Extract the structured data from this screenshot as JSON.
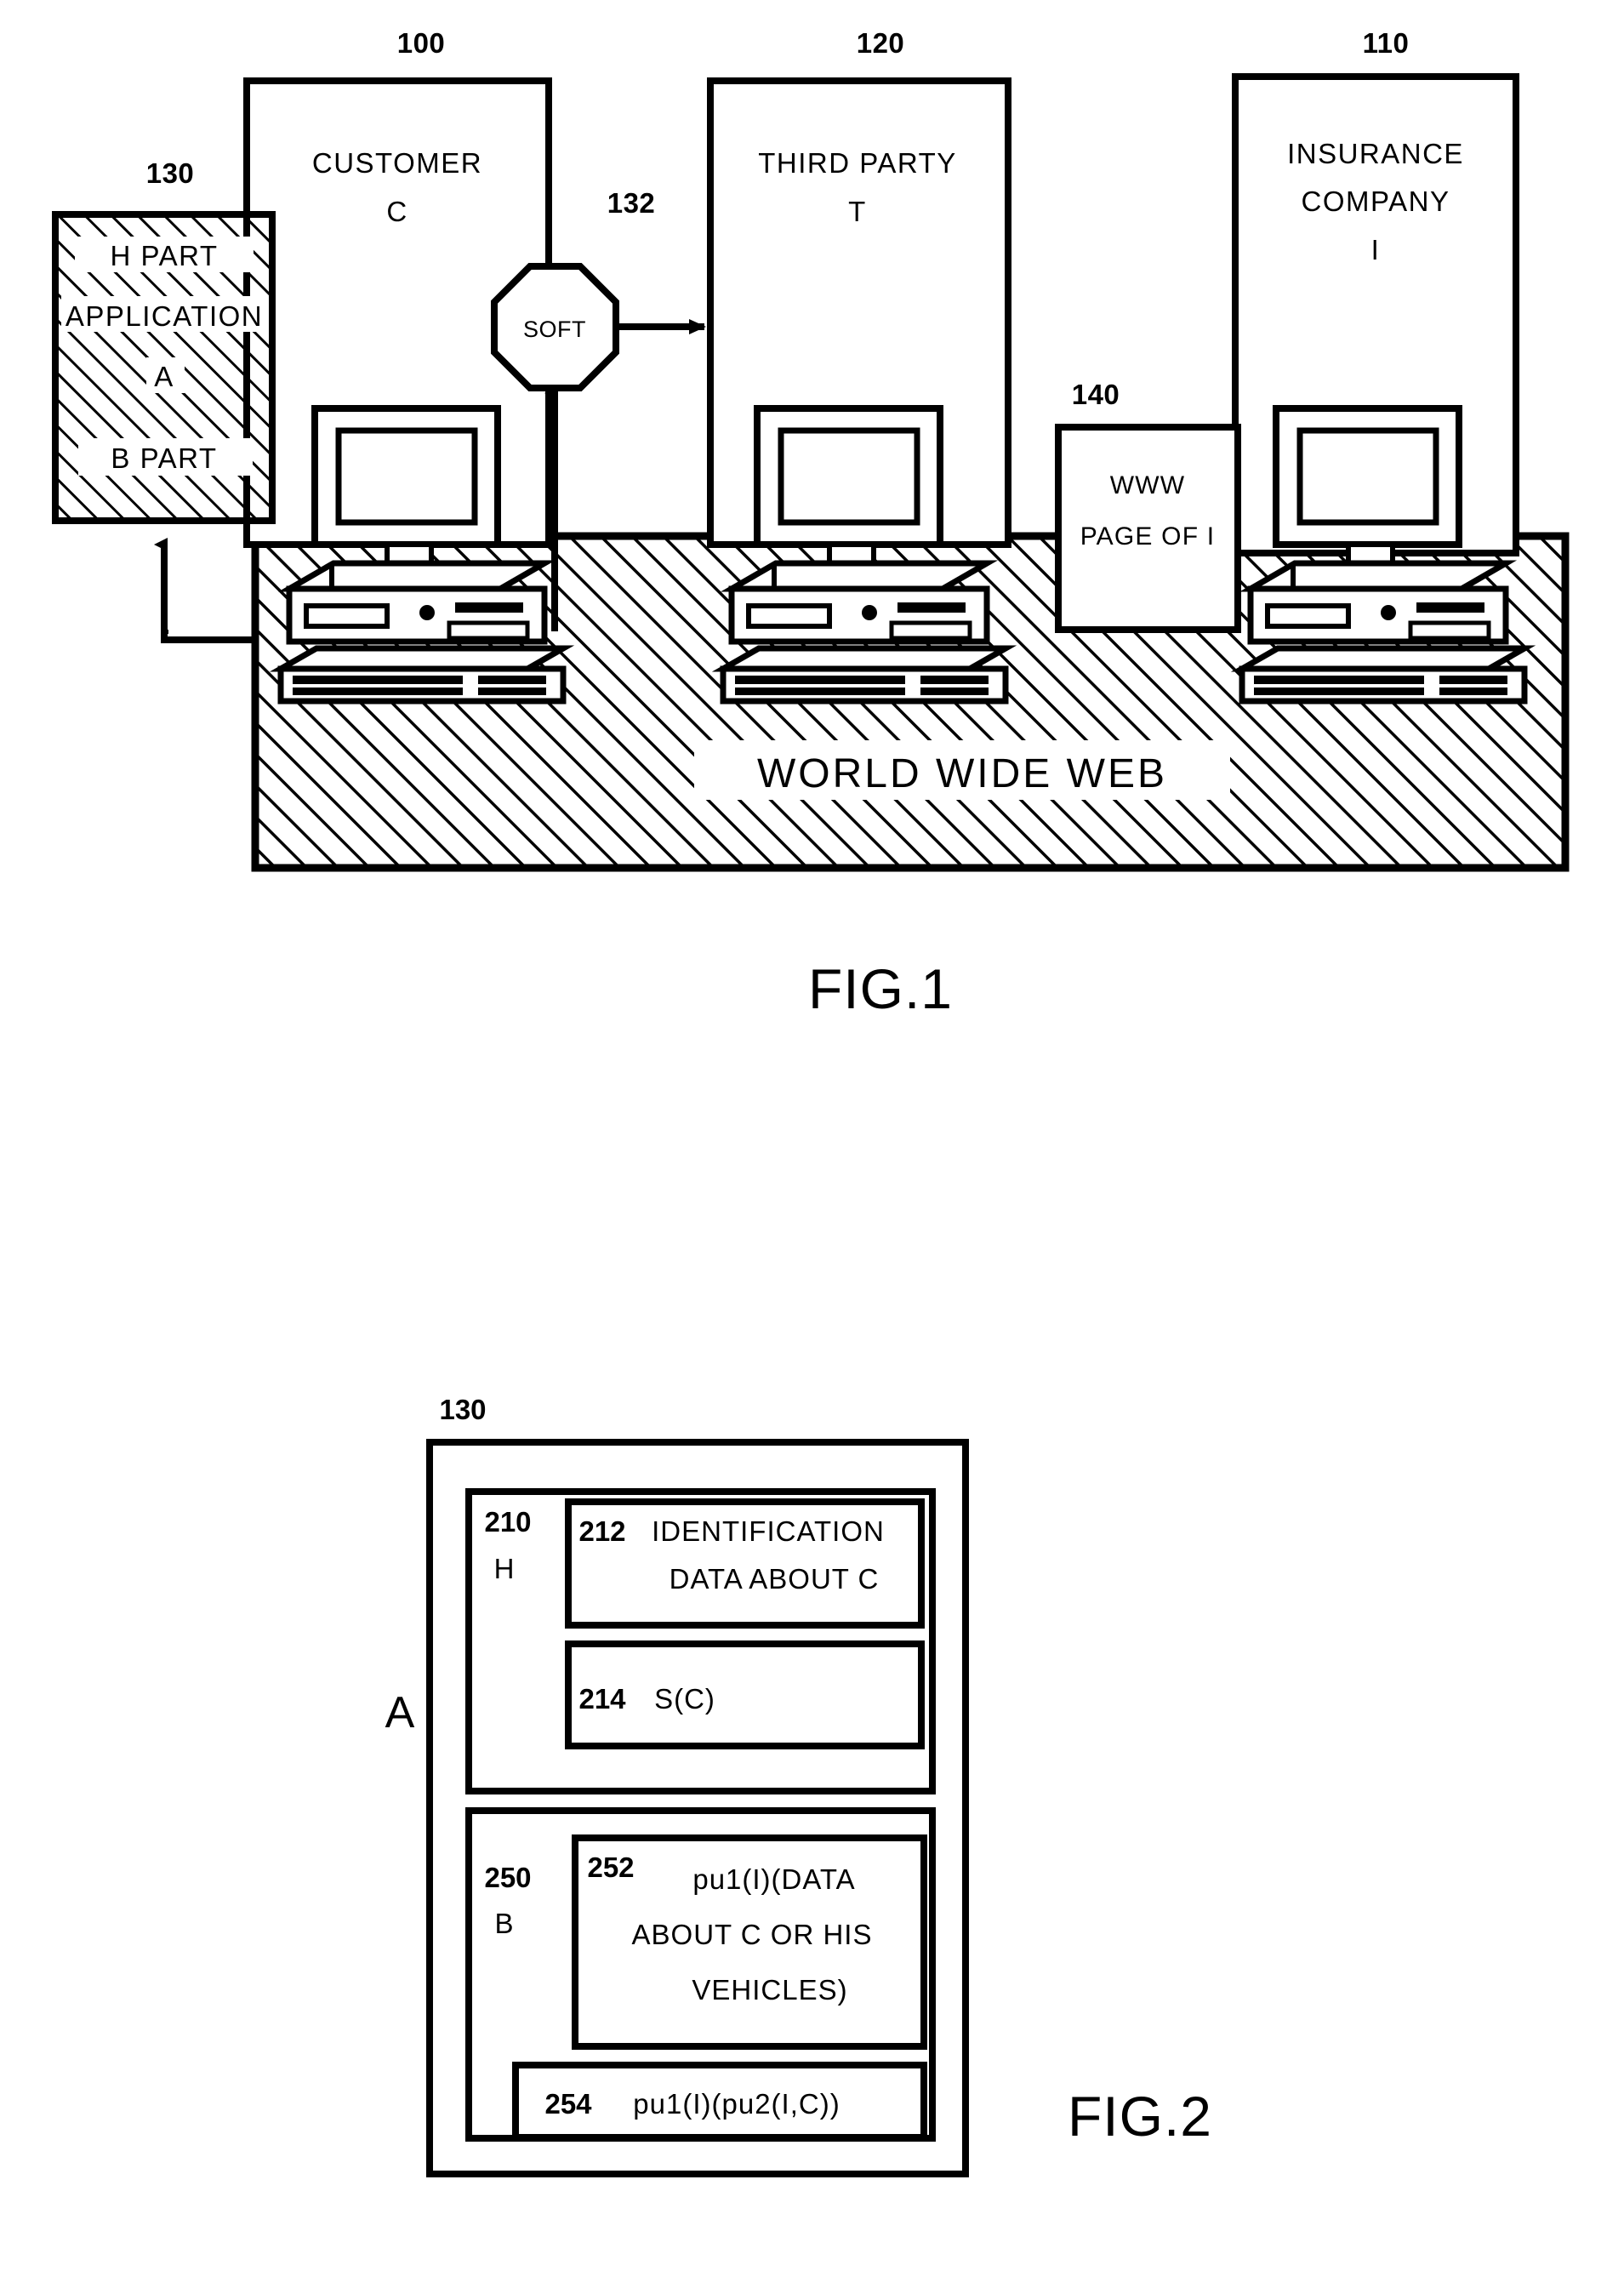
{
  "document": {
    "type": "patent-figure-sheet",
    "figures": [
      {
        "caption": "FIG.1"
      },
      {
        "caption": "FIG.2"
      }
    ]
  },
  "fig1": {
    "caption": "FIG.1",
    "refs": {
      "customer": "100",
      "insurance": "110",
      "third_party": "120",
      "application": "130",
      "soft": "132",
      "www_page": "140"
    },
    "boxes": {
      "customer": {
        "ref": "100",
        "line1": "CUSTOMER",
        "line2": "C"
      },
      "third_party": {
        "ref": "120",
        "line1": "THIRD PARTY",
        "line2": "T"
      },
      "insurance": {
        "ref": "110",
        "line1": "INSURANCE",
        "line2": "COMPANY",
        "line3": "I"
      },
      "application": {
        "ref": "130",
        "line1": "H PART",
        "line2": "APPLICATION",
        "line3": "A",
        "line4": "B PART"
      },
      "www_page": {
        "ref": "140",
        "line1": "WWW",
        "line2": "PAGE OF I"
      },
      "soft": {
        "ref": "132",
        "label": "SOFT"
      }
    },
    "network": {
      "label": "WORLD WIDE WEB"
    },
    "workstations": [
      {
        "name": "customer-workstation"
      },
      {
        "name": "third-party-workstation"
      },
      {
        "name": "insurance-workstation"
      }
    ]
  },
  "fig2": {
    "caption": "FIG.2",
    "outer_ref": "130",
    "outer_side_label": "A",
    "sections": [
      {
        "ref": "210",
        "letter": "H",
        "items": [
          {
            "ref": "212",
            "lines": [
              "IDENTIFICATION",
              "DATA ABOUT C"
            ]
          },
          {
            "ref": "214",
            "lines": [
              "S(C)"
            ]
          }
        ]
      },
      {
        "ref": "250",
        "letter": "B",
        "items": [
          {
            "ref": "252",
            "lines": [
              "pu1(I)(DATA",
              "ABOUT C OR HIS",
              "VEHICLES)"
            ]
          },
          {
            "ref": "254",
            "lines": [
              "pu1(I)(pu2(I,C))"
            ]
          }
        ]
      }
    ]
  }
}
